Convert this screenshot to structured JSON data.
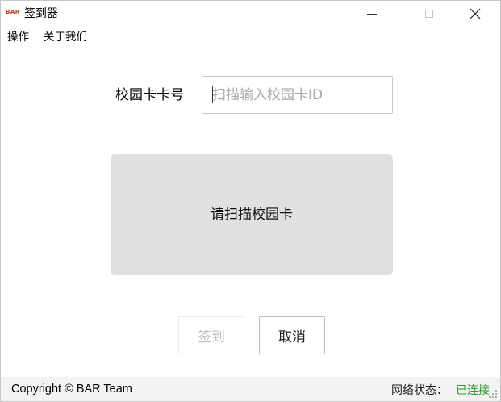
{
  "window": {
    "title": "签到器",
    "logo_text": "BAR"
  },
  "menu": {
    "items": [
      "操作",
      "关于我们"
    ]
  },
  "form": {
    "card_label": "校园卡卡号",
    "card_input_placeholder": "扫描输入校园卡ID",
    "card_input_value": ""
  },
  "scan_panel": {
    "prompt": "请扫描校园卡"
  },
  "buttons": {
    "signin": "签到",
    "cancel": "取消"
  },
  "status": {
    "copyright": "Copyright © BAR Team",
    "network_label": "网络状态：",
    "network_value": "已连接",
    "network_color": "#2e9b2e"
  },
  "icons": {
    "minimize": "minimize-icon",
    "maximize": "maximize-icon",
    "close": "close-icon"
  }
}
